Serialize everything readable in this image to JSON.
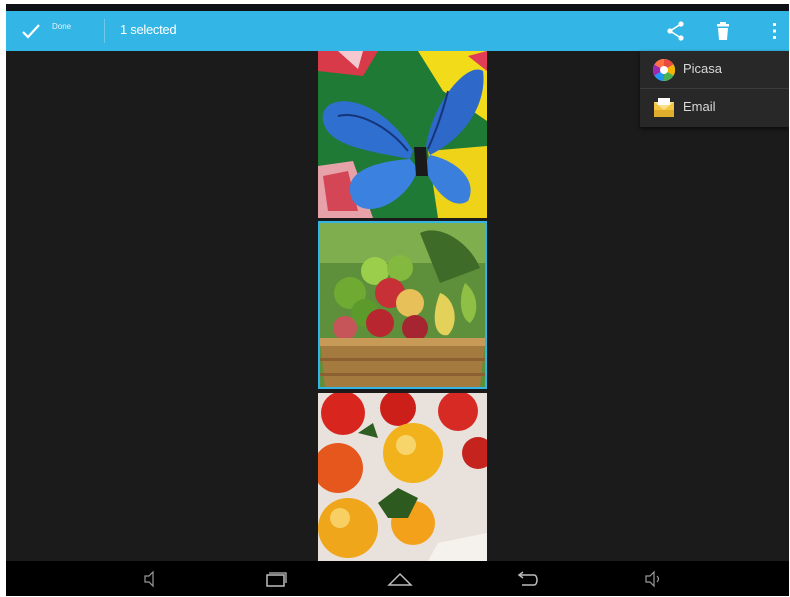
{
  "action_bar": {
    "done_label": "Done",
    "selection_title": "1 selected",
    "color": "#33b5e5"
  },
  "toolbar_icons": [
    "share-icon",
    "delete-icon",
    "overflow-menu-icon"
  ],
  "share_menu": {
    "items": [
      {
        "label": "Picasa",
        "icon": "picasa-icon"
      },
      {
        "label": "Email",
        "icon": "email-icon"
      }
    ]
  },
  "photos": [
    {
      "subject": "butterfly-image",
      "selected": false
    },
    {
      "subject": "fruit-basket-image",
      "selected": true
    },
    {
      "subject": "tomatoes-image",
      "selected": false
    }
  ],
  "nav_bar": {
    "buttons": [
      "volume-down-icon",
      "recent-apps-icon",
      "home-icon",
      "back-icon",
      "volume-up-icon"
    ]
  }
}
